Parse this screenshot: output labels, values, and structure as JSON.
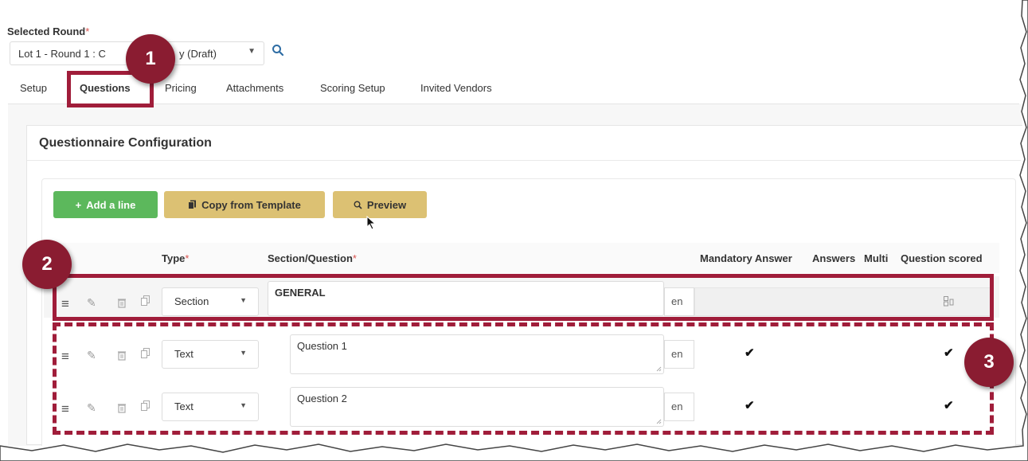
{
  "selected_round": {
    "label": "Selected Round",
    "required_mark": "*",
    "value": "Lot 1 - Round 1 : Questionnaire (Draft)",
    "visible_value_left": "Lot 1 - Round 1 : C",
    "visible_value_right": "y (Draft)"
  },
  "tabs": [
    {
      "label": "Setup"
    },
    {
      "label": "Questions",
      "active": true
    },
    {
      "label": "Pricing"
    },
    {
      "label": "Attachments"
    },
    {
      "label": "Scoring Setup"
    },
    {
      "label": "Invited Vendors"
    }
  ],
  "panel": {
    "title": "Questionnaire Configuration"
  },
  "toolbar": {
    "add_line": "Add a line",
    "copy_template": "Copy from Template",
    "preview": "Preview"
  },
  "columns": {
    "type": "Type",
    "section_question": "Section/Question",
    "mandatory": "Mandatory Answer",
    "answers": "Answers",
    "multi": "Multi",
    "scored": "Question scored"
  },
  "rows": [
    {
      "type": "Section",
      "text": "GENERAL",
      "lang": "en",
      "mandatory": false,
      "scored": false
    },
    {
      "type": "Text",
      "text": "Question 1",
      "lang": "en",
      "mandatory": true,
      "scored": true
    },
    {
      "type": "Text",
      "text": "Question 2",
      "lang": "en",
      "mandatory": true,
      "scored": true
    }
  ],
  "annotations": {
    "b1": "1",
    "b2": "2",
    "b3": "3"
  },
  "icons": [
    "search-icon",
    "drag-handle-icon",
    "pencil-icon",
    "trash-icon",
    "copy-icon",
    "plus-icon",
    "document-icon",
    "magnifier-icon",
    "checkmark-icon",
    "mouse-cursor-icon"
  ],
  "colors": {
    "accent_add": "#5cb85c",
    "accent_template": "#dcc173",
    "highlight": "#a01d3a",
    "badge": "#8a1c31"
  }
}
